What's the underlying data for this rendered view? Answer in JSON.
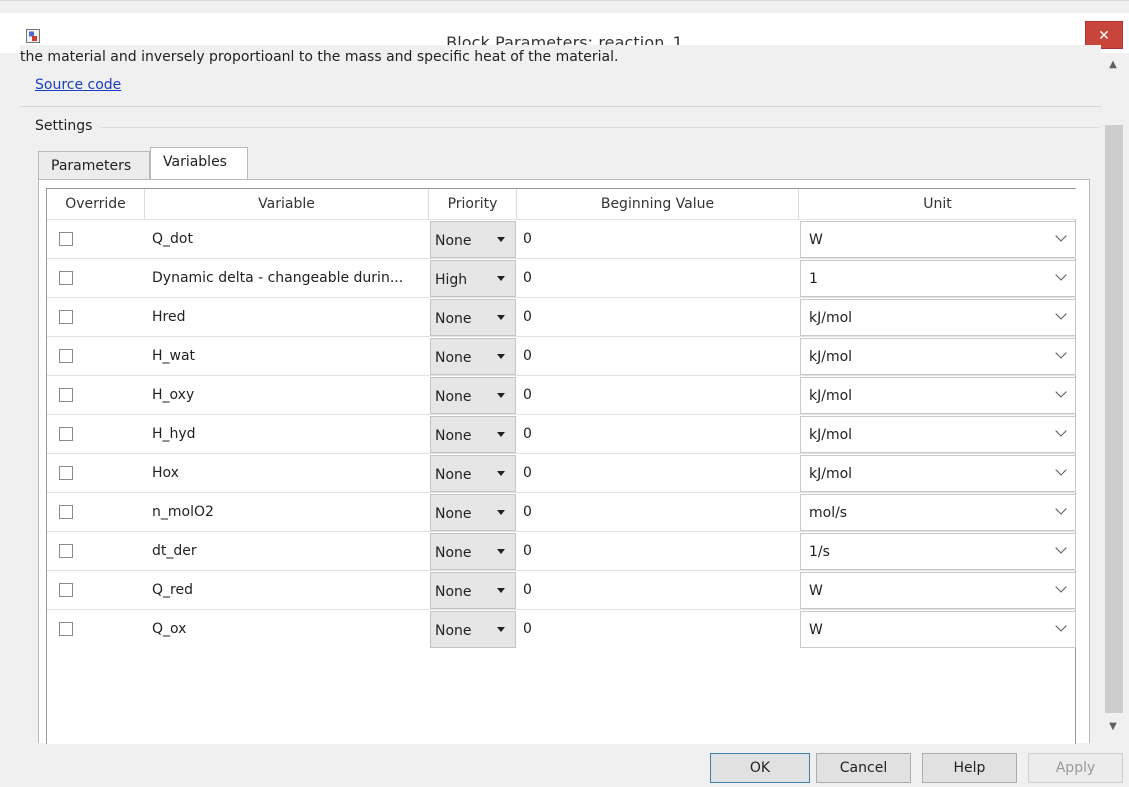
{
  "window": {
    "title": "Block Parameters: reaction_1",
    "close_glyph": "✕"
  },
  "description": {
    "text": "the material and inversely proportioanl to the mass and specific heat of the material.",
    "source_link": "Source code"
  },
  "settings": {
    "label": "Settings",
    "tabs": [
      "Parameters",
      "Variables"
    ],
    "active_tab": "Variables"
  },
  "table": {
    "headers": [
      "Override",
      "Variable",
      "Priority",
      "Beginning Value",
      "Unit"
    ],
    "rows": [
      {
        "override": false,
        "variable": "Q_dot",
        "priority": "None",
        "beginning_value": "0",
        "unit": "W"
      },
      {
        "override": false,
        "variable": "Dynamic delta - changeable durin...",
        "priority": "High",
        "beginning_value": "0",
        "unit": "1"
      },
      {
        "override": false,
        "variable": "Hred",
        "priority": "None",
        "beginning_value": "0",
        "unit": "kJ/mol"
      },
      {
        "override": false,
        "variable": "H_wat",
        "priority": "None",
        "beginning_value": "0",
        "unit": "kJ/mol"
      },
      {
        "override": false,
        "variable": "H_oxy",
        "priority": "None",
        "beginning_value": "0",
        "unit": "kJ/mol"
      },
      {
        "override": false,
        "variable": "H_hyd",
        "priority": "None",
        "beginning_value": "0",
        "unit": "kJ/mol"
      },
      {
        "override": false,
        "variable": "Hox",
        "priority": "None",
        "beginning_value": "0",
        "unit": "kJ/mol"
      },
      {
        "override": false,
        "variable": "n_molO2",
        "priority": "None",
        "beginning_value": "0",
        "unit": "mol/s"
      },
      {
        "override": false,
        "variable": "dt_der",
        "priority": "None",
        "beginning_value": "0",
        "unit": "1/s"
      },
      {
        "override": false,
        "variable": "Q_red",
        "priority": "None",
        "beginning_value": "0",
        "unit": "W"
      },
      {
        "override": false,
        "variable": "Q_ox",
        "priority": "None",
        "beginning_value": "0",
        "unit": "W"
      }
    ]
  },
  "buttons": {
    "ok": "OK",
    "cancel": "Cancel",
    "help": "Help",
    "apply": "Apply"
  },
  "colors": {
    "close_button": "#c7453a",
    "link": "#1a3dbf"
  },
  "icons": {
    "app": "simulink-block-icon",
    "scroll_up": "chevron-up-icon",
    "scroll_down": "chevron-down-icon"
  }
}
